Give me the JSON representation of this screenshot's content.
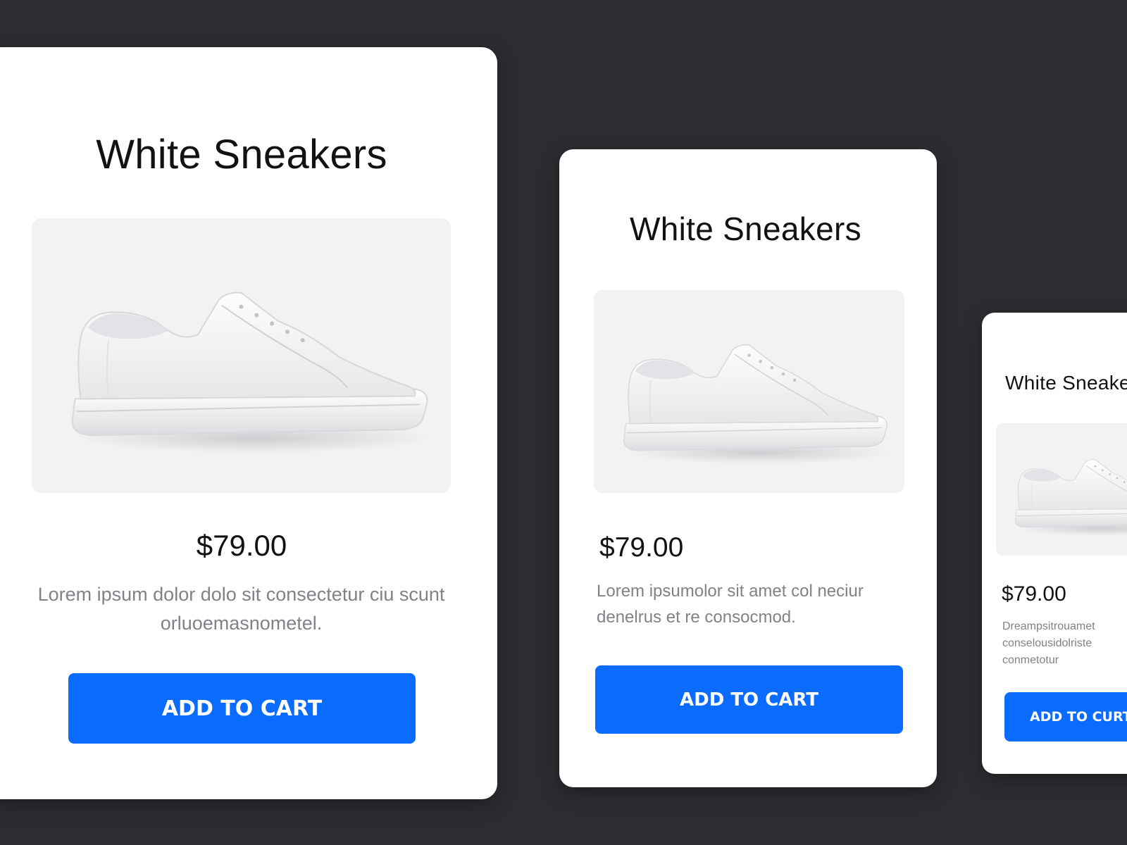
{
  "cards": [
    {
      "title": "White Sneakers",
      "image_alt": "white sneaker product photo",
      "price": "$79.00",
      "description": "Lorem ipsum dolor dolo sit consectetur ciu scunt orluoemasnometel.",
      "button_label": "ADD TO CART"
    },
    {
      "title": "White Sneakers",
      "image_alt": "white sneaker product photo",
      "price": "$79.00",
      "description": "Lorem ipsumolor sit amet col neciur denelrus et re consocmod.",
      "button_label": "ADD TO CART"
    },
    {
      "title": "White Sneake",
      "image_alt": "white sneaker product photo",
      "price": "$79.00",
      "description": "Dreampsitrouamet conselousidolriste conmetotur",
      "button_label": "ADD TO CURT"
    }
  ],
  "colors": {
    "background": "#2b2d31",
    "card": "#ffffff",
    "button": "#0a6cff",
    "button_text": "#ffffff",
    "title_text": "#111214",
    "description_text": "#7f8287",
    "image_background": "#f2f2f3"
  }
}
